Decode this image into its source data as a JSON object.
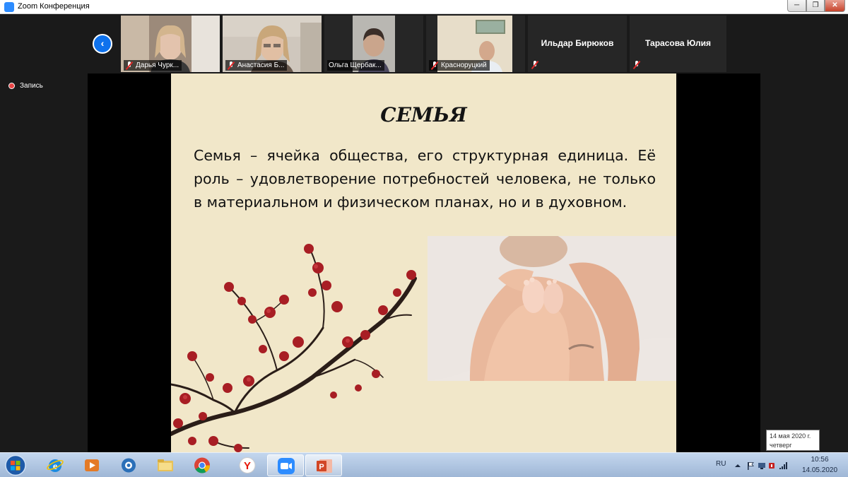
{
  "window": {
    "title": "Zoom Конференция",
    "min_label": "─",
    "max_label": "❐",
    "close_label": "✕"
  },
  "gallery": {
    "back_label": "‹",
    "participants": [
      {
        "name": "Дарья Чурк..."
      },
      {
        "name": "Анастасия Б..."
      },
      {
        "name": "Ольга Щербак..."
      },
      {
        "name": "Красноруцкий"
      },
      {
        "name": "Ильдар Бирюков"
      },
      {
        "name": "Тарасова Юлия"
      }
    ]
  },
  "recording": {
    "label": "Запись"
  },
  "slide": {
    "title": "СЕМЬЯ",
    "body": "Семья – ячейка общества, его структурная единица. Её роль – удовлетворение потребностей человека, не только в материальном и физическом планах, но и в духовном."
  },
  "taskbar": {
    "apps": [
      {
        "name": "internet-explorer-icon"
      },
      {
        "name": "media-player-icon"
      },
      {
        "name": "media-center-icon"
      },
      {
        "name": "file-explorer-icon"
      },
      {
        "name": "chrome-icon"
      },
      {
        "name": "yandex-browser-icon"
      },
      {
        "name": "zoom-icon"
      },
      {
        "name": "powerpoint-icon"
      }
    ],
    "lang": "RU",
    "time": "10:56",
    "date": "14.05.2020"
  },
  "tooltip": {
    "date_long": "14 мая 2020 г.",
    "weekday": "четверг"
  },
  "colors": {
    "zoom_blue": "#0e72ed",
    "slide_bg": "#f1e7c9",
    "muted_red": "#e02828",
    "blossom_red": "#a81e24"
  }
}
